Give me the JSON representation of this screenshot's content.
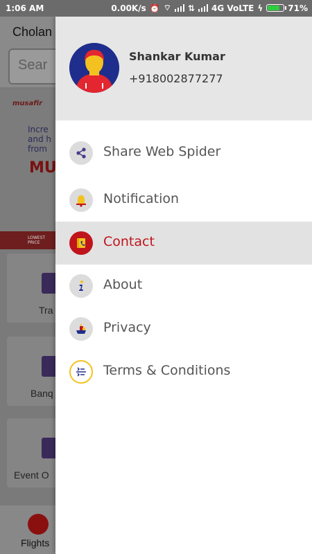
{
  "status_bar": {
    "time": "1:06 AM",
    "network_speed": "0.00K/s",
    "network_type": "4G VoLTE",
    "battery": "71%"
  },
  "background_app": {
    "title": "Cholan",
    "search_placeholder": "Sear",
    "banner_logo": "musafir",
    "banner_text": "Incre and h from",
    "banner_big_text": "MU",
    "strip_text": "LOWEST PRICE",
    "cards": [
      {
        "label": "Tra"
      },
      {
        "label": "Banq"
      },
      {
        "label": "Event O"
      }
    ],
    "bottom_tab": "Flights"
  },
  "drawer": {
    "user": {
      "name": "Shankar Kumar",
      "phone": "+918002877277"
    },
    "menu": [
      {
        "label": "Share Web Spider",
        "icon": "share-icon"
      },
      {
        "label": "Notification",
        "icon": "bell-icon"
      },
      {
        "label": "Contact",
        "icon": "phone-book-icon",
        "active": true
      },
      {
        "label": "About",
        "icon": "info-icon"
      },
      {
        "label": "Privacy",
        "icon": "privacy-icon"
      },
      {
        "label": "Terms & Conditions",
        "icon": "terms-icon"
      }
    ]
  },
  "colors": {
    "accent": "#c0141c",
    "drawer_header": "#e6e6e6",
    "active_item_bg": "#e2e2e2"
  }
}
